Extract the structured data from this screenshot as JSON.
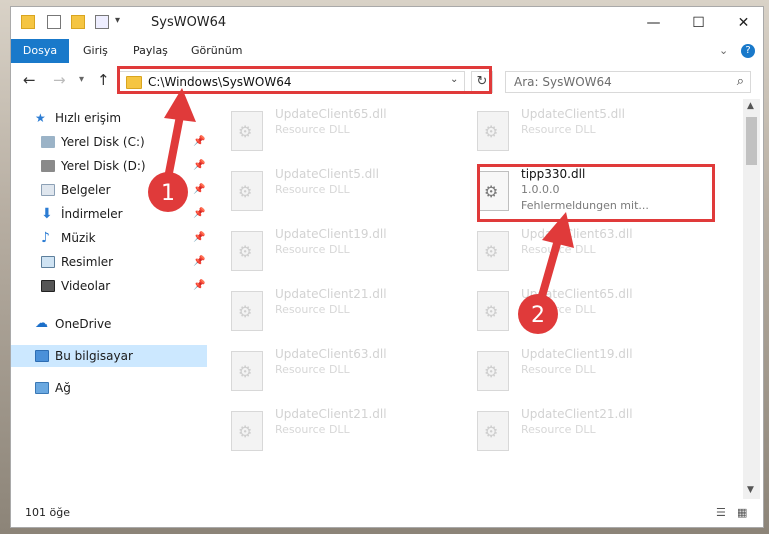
{
  "window": {
    "title": "SysWOW64",
    "controls": {
      "minimize": "—",
      "maximize": "☐",
      "close": "✕"
    }
  },
  "ribbon": {
    "tabs": [
      "Dosya",
      "Giriş",
      "Paylaş",
      "Görünüm"
    ],
    "expand_glyph": "⌄",
    "help_glyph": "?"
  },
  "address_bar": {
    "path": "C:\\Windows\\SysWOW64",
    "search_placeholder": "Ara: SysWOW64"
  },
  "sidebar": {
    "quick_access": "Hızlı erişim",
    "items": [
      {
        "label": "Yerel Disk (C:)",
        "icon": "drive-icon",
        "pinned": true
      },
      {
        "label": "Yerel Disk (D:)",
        "icon": "drive-icon",
        "pinned": true
      },
      {
        "label": "Belgeler",
        "icon": "documents-icon",
        "pinned": true
      },
      {
        "label": "İndirmeler",
        "icon": "download-icon",
        "pinned": true
      },
      {
        "label": "Müzik",
        "icon": "music-icon",
        "pinned": true
      },
      {
        "label": "Resimler",
        "icon": "pictures-icon",
        "pinned": true
      },
      {
        "label": "Videolar",
        "icon": "videos-icon",
        "pinned": true
      }
    ],
    "onedrive": "OneDrive",
    "this_pc": "Bu bilgisayar",
    "network": "Ağ"
  },
  "files": {
    "left": [
      {
        "name": "UpdateClient65.dll",
        "type": "Resource DLL"
      },
      {
        "name": "UpdateClient5.dll",
        "type": "Resource DLL"
      },
      {
        "name": "UpdateClient19.dll",
        "type": "Resource DLL"
      },
      {
        "name": "UpdateClient21.dll",
        "type": "Resource DLL"
      },
      {
        "name": "UpdateClient63.dll",
        "type": "Resource DLL"
      },
      {
        "name": "UpdateClient21.dll",
        "type": "Resource DLL"
      }
    ],
    "right": [
      {
        "name": "UpdateClient5.dll",
        "type": "Resource DLL"
      },
      {
        "name": "UpdateClient63.dll",
        "type": "Resource DLL"
      },
      {
        "name": "UpdateClient65.dll",
        "type": "Resource DLL"
      },
      {
        "name": "UpdateClient19.dll",
        "type": "Resource DLL"
      },
      {
        "name": "UpdateClient21.dll",
        "type": "Resource DLL"
      }
    ],
    "highlighted": {
      "name": "tipp330.dll",
      "version": "1.0.0.0",
      "description": "Fehlermeldungen mit..."
    }
  },
  "status_bar": {
    "item_count": "101 öğe"
  },
  "annotations": {
    "badge1": "1",
    "badge2": "2",
    "color": "#e03a3a"
  }
}
